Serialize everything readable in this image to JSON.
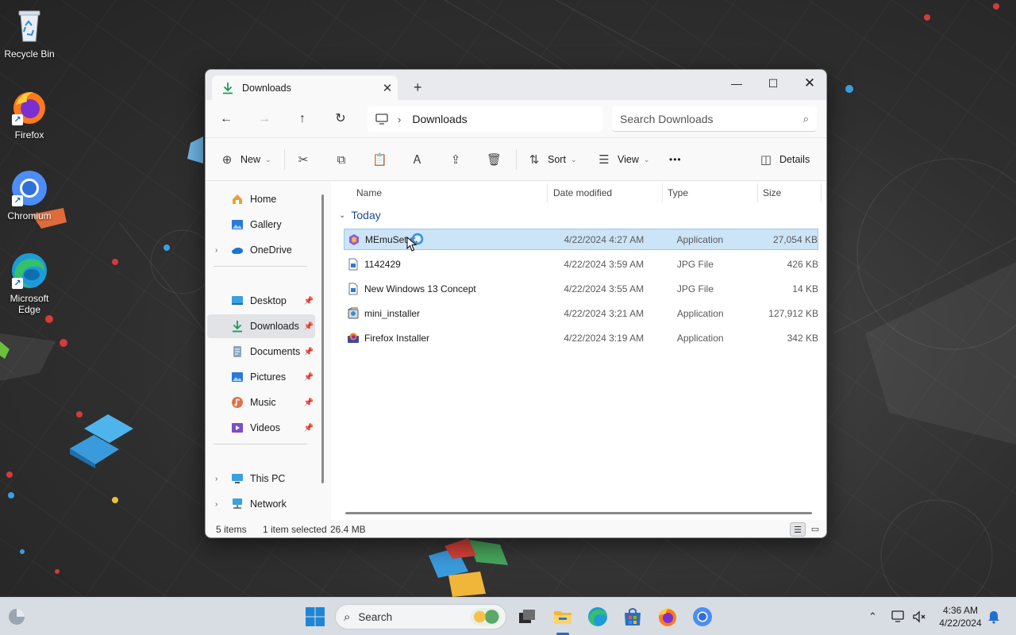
{
  "desktop": {
    "icons": [
      {
        "label": "Recycle Bin"
      },
      {
        "label": "Firefox"
      },
      {
        "label": "Chromium"
      },
      {
        "label": "Microsoft Edge"
      }
    ]
  },
  "window": {
    "tab_title": "Downloads",
    "tab_close_glyph": "✕",
    "new_tab_glyph": "+",
    "controls": {
      "minimize": "—",
      "maximize": "☐",
      "close": "✕"
    },
    "address": {
      "location_icon": "this-pc-icon",
      "breadcrumb": "Downloads",
      "search_placeholder": "Search Downloads"
    },
    "commands": {
      "new": "New",
      "sort": "Sort",
      "view": "View",
      "more": "•••",
      "details": "Details"
    },
    "nav": {
      "items": [
        {
          "label": "Home"
        },
        {
          "label": "Gallery"
        },
        {
          "label": "OneDrive"
        },
        {
          "label": "Desktop"
        },
        {
          "label": "Downloads"
        },
        {
          "label": "Documents"
        },
        {
          "label": "Pictures"
        },
        {
          "label": "Music"
        },
        {
          "label": "Videos"
        },
        {
          "label": "This PC"
        },
        {
          "label": "Network"
        }
      ],
      "selected": "Downloads"
    },
    "columns": {
      "name": "Name",
      "date": "Date modified",
      "type": "Type",
      "size": "Size"
    },
    "group": "Today",
    "files": [
      {
        "name": "MEmuSetup",
        "date": "4/22/2024 4:27 AM",
        "type": "Application",
        "size": "27,054 KB",
        "icon": "memu-app-icon",
        "selected": true
      },
      {
        "name": "1142429",
        "date": "4/22/2024 3:59 AM",
        "type": "JPG File",
        "size": "426 KB",
        "icon": "image-file-icon",
        "selected": false
      },
      {
        "name": "New Windows 13 Concept",
        "date": "4/22/2024 3:55 AM",
        "type": "JPG File",
        "size": "14 KB",
        "icon": "image-file-icon",
        "selected": false
      },
      {
        "name": "mini_installer",
        "date": "4/22/2024 3:21 AM",
        "type": "Application",
        "size": "127,912 KB",
        "icon": "installer-icon",
        "selected": false
      },
      {
        "name": "Firefox Installer",
        "date": "4/22/2024 3:19 AM",
        "type": "Application",
        "size": "342 KB",
        "icon": "firefox-installer-icon",
        "selected": false
      }
    ],
    "status": {
      "items": "5 items",
      "selected": "1 item selected",
      "size": "26.4 MB"
    }
  },
  "taskbar": {
    "search_label": "Search",
    "time": "4:36 AM",
    "date": "4/22/2024"
  },
  "colors": {
    "accent": "#0067c0",
    "selection": "#cce4f7",
    "taskbar": "#d8dde3"
  }
}
